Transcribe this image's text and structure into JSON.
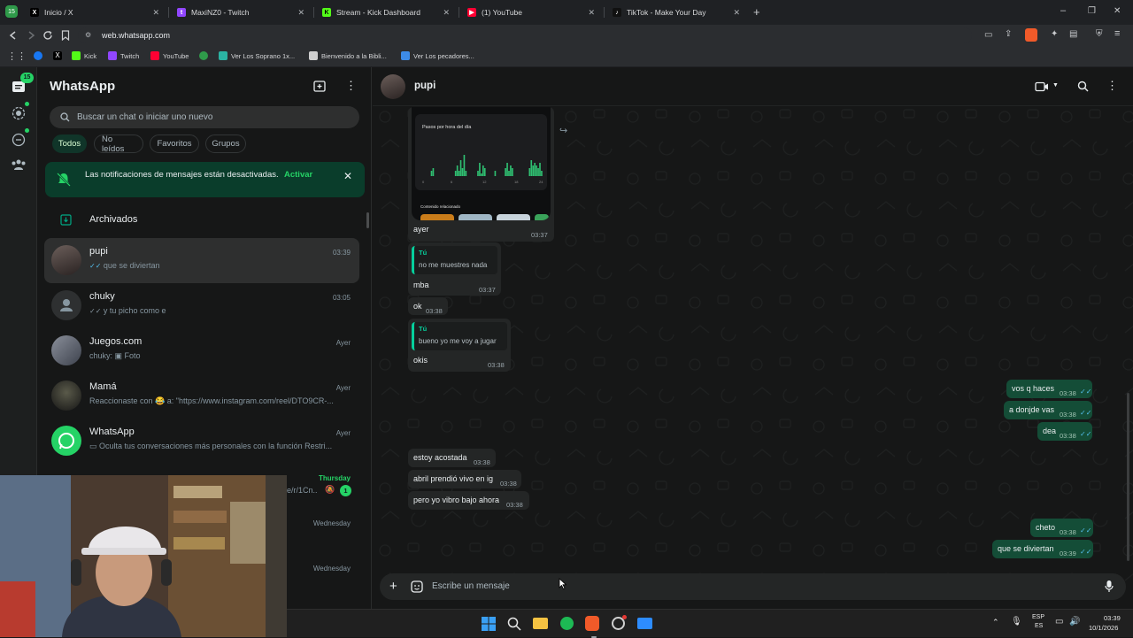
{
  "browser": {
    "tabs": [
      {
        "label": "Inicio / X",
        "icon": "x-logo-icon",
        "color": "#000000"
      },
      {
        "label": "MaxiNZ0 - Twitch",
        "icon": "twitch-logo-icon",
        "color": "#9146ff"
      },
      {
        "label": "Stream - Kick Dashboard",
        "icon": "kick-logo-icon",
        "color": "#53fc18"
      },
      {
        "label": "(1) YouTube",
        "icon": "youtube-logo-icon",
        "color": "#ff0033"
      },
      {
        "label": "TikTok - Make Your Day",
        "icon": "tiktok-logo-icon",
        "color": "#111111"
      }
    ],
    "url": "web.whatsapp.com",
    "bookmarks": [
      "Kick",
      "Twitch",
      "YouTube",
      "Ver Los Soprano 1x...",
      "Bienvenido a la Bibli...",
      "Ver Los pecadores..."
    ]
  },
  "rail": {
    "badge": "15"
  },
  "sidebar": {
    "title": "WhatsApp",
    "search_placeholder": "Buscar un chat o iniciar uno nuevo",
    "filters": [
      "Todos",
      "No leídos",
      "Favoritos",
      "Grupos"
    ],
    "notice": {
      "text": "Las notificaciones de mensajes están desactivadas.",
      "action": "Activar"
    },
    "archived": "Archivados",
    "chats": [
      {
        "name": "pupi",
        "time": "03:39",
        "preview": "que se diviertan",
        "ticks": "✓✓"
      },
      {
        "name": "chuky",
        "time": "03:05",
        "preview": "y tu picho como e",
        "ticks": "✓✓"
      },
      {
        "name": "Juegos.com",
        "time": "Ayer",
        "preview": "chuky: ▣ Foto"
      },
      {
        "name": "Mamá",
        "time": "Ayer",
        "preview": "Reaccionaste con 😂 a: \"https://www.instagram.com/reel/DTO9CR-..."
      },
      {
        "name": "WhatsApp",
        "time": "Ayer",
        "preview": "Oculta tus conversaciones más personales con la función Restri..."
      },
      {
        "name": "",
        "time": "Thursday",
        "preview": "e/r/1Cn..",
        "unread": "1"
      },
      {
        "name": "",
        "time": "Wednesday",
        "preview": ""
      },
      {
        "name": "",
        "time": "Wednesday",
        "preview": ""
      }
    ]
  },
  "chat": {
    "contact": "pupi",
    "screenshot_card": {
      "heading": "Pasos por hora del día",
      "footer": "Contenido relacionado",
      "ticks": [
        "0",
        "6",
        "12",
        "18",
        "24"
      ]
    },
    "messages": [
      {
        "dir": "in",
        "text": "ayer",
        "time": "03:37"
      },
      {
        "dir": "in",
        "quote_author": "Tú",
        "quote": "no me muestres nada",
        "text": "mba",
        "time": "03:37"
      },
      {
        "dir": "in",
        "text": "ok",
        "time": "03:38"
      },
      {
        "dir": "in",
        "quote_author": "Tú",
        "quote": "bueno yo me voy a jugar",
        "text": "okis",
        "time": "03:38"
      },
      {
        "dir": "out",
        "text": "vos q haces",
        "time": "03:38"
      },
      {
        "dir": "out",
        "text": "a donjde vas",
        "time": "03:38"
      },
      {
        "dir": "out",
        "text": "dea",
        "time": "03:38"
      },
      {
        "dir": "in",
        "text": "estoy acostada",
        "time": "03:38"
      },
      {
        "dir": "in",
        "text": "abril prendió vivo en ig",
        "time": "03:38"
      },
      {
        "dir": "in",
        "text": "pero yo vibro bajo ahora",
        "time": "03:38"
      },
      {
        "dir": "out",
        "text": "cheto",
        "time": "03:38"
      },
      {
        "dir": "out",
        "text": "que se diviertan",
        "time": "03:39"
      }
    ],
    "composer_placeholder": "Escribe un mensaje"
  },
  "taskbar": {
    "lang": "ESP",
    "lang2": "ES",
    "time": "03:39",
    "date": "10/1/2026"
  },
  "colors": {
    "accent": "#00a884",
    "bubble_out": "#144d37",
    "bubble_in": "#242626",
    "read_ticks": "#53bdeb"
  }
}
